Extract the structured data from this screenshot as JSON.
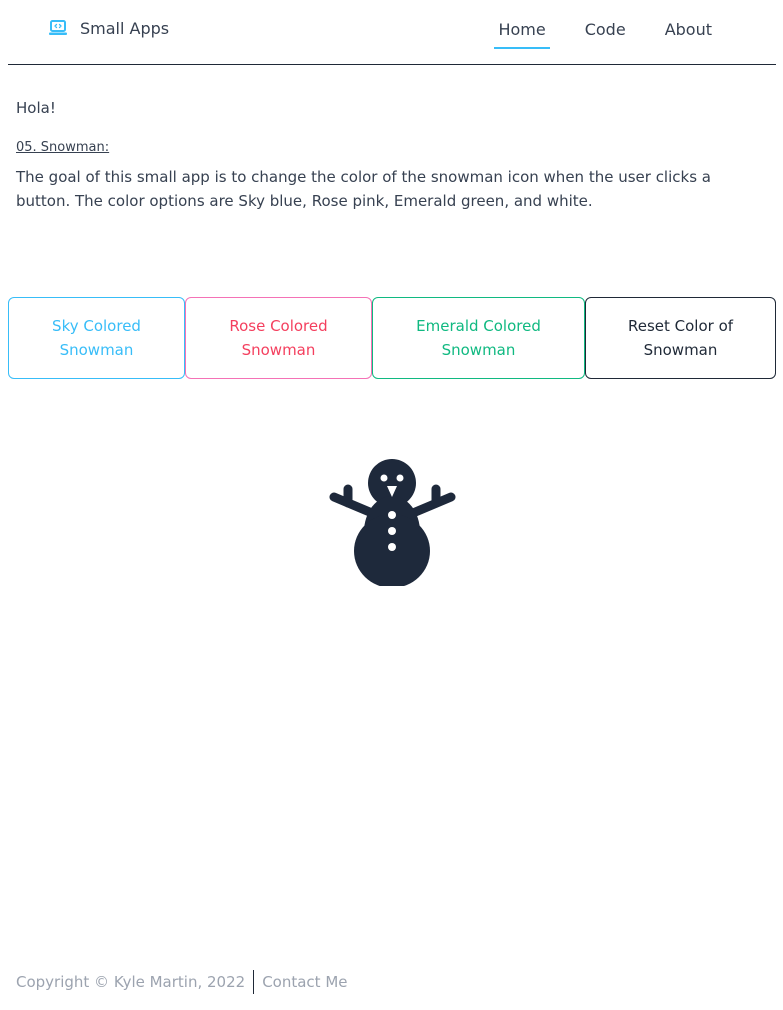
{
  "header": {
    "brand": "Small Apps",
    "nav": [
      {
        "label": "Home",
        "active": true
      },
      {
        "label": "Code",
        "active": false
      },
      {
        "label": "About",
        "active": false
      }
    ]
  },
  "content": {
    "greeting": "Hola!",
    "app_title": "05. Snowman:",
    "description": "The goal of this small app is to change the color of the snowman icon when the user clicks a button. The color options are Sky blue, Rose pink, Emerald green, and white."
  },
  "buttons": {
    "sky": "Sky Colored Snowman",
    "rose": "Rose Colored Snowman",
    "emerald": "Emerald Colored Snowman",
    "reset": "Reset Color of Snowman"
  },
  "snowman": {
    "icon": "snowman-icon",
    "color": "#1e293b"
  },
  "footer": {
    "copyright": "Copyright © Kyle Martin, 2022",
    "contact": "Contact Me"
  },
  "colors": {
    "sky": "#38bdf8",
    "rose": "#f43f5e",
    "emerald": "#10b981",
    "dark": "#1f2937"
  }
}
